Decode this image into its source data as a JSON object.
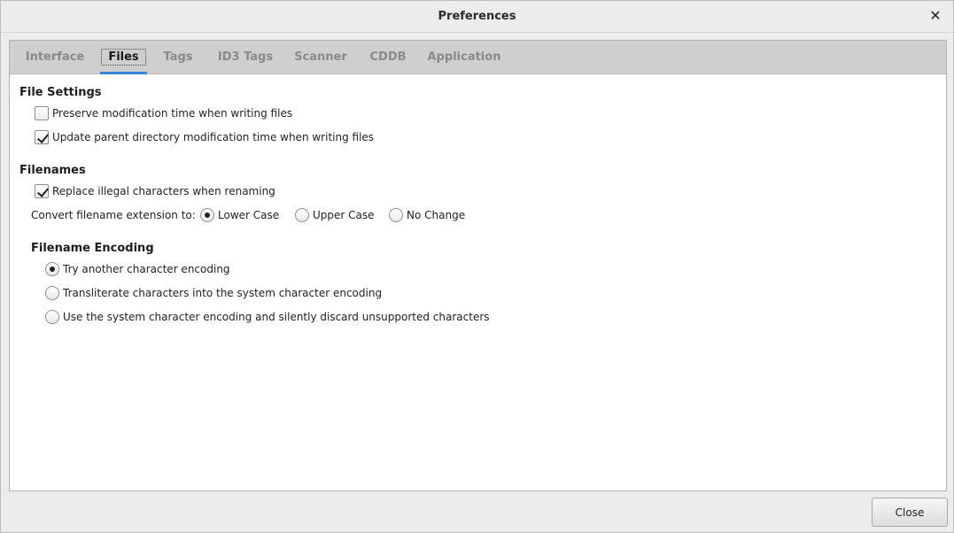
{
  "window": {
    "title": "Preferences",
    "close_icon": "close-icon"
  },
  "tabs": [
    {
      "label": "Interface",
      "active": false
    },
    {
      "label": "Files",
      "active": true
    },
    {
      "label": "Tags",
      "active": false
    },
    {
      "label": "ID3 Tags",
      "active": false
    },
    {
      "label": "Scanner",
      "active": false
    },
    {
      "label": "CDDB",
      "active": false
    },
    {
      "label": "Application",
      "active": false
    }
  ],
  "file_settings": {
    "heading": "File Settings",
    "preserve_mtime": {
      "label": "Preserve modification time when writing files",
      "checked": false
    },
    "update_parent_mtime": {
      "label": "Update parent directory modification time when writing files",
      "checked": true
    }
  },
  "filenames": {
    "heading": "Filenames",
    "replace_illegal": {
      "label": "Replace illegal characters when renaming",
      "checked": true
    },
    "extension_label": "Convert filename extension to:",
    "extension_options": [
      {
        "label": "Lower Case",
        "selected": true
      },
      {
        "label": "Upper Case",
        "selected": false
      },
      {
        "label": "No Change",
        "selected": false
      }
    ]
  },
  "filename_encoding": {
    "heading": "Filename Encoding",
    "options": [
      {
        "label": "Try another character encoding",
        "selected": true
      },
      {
        "label": "Transliterate characters into the system character encoding",
        "selected": false
      },
      {
        "label": "Use the system character encoding and silently discard unsupported characters",
        "selected": false
      }
    ]
  },
  "footer": {
    "close_label": "Close"
  },
  "colors": {
    "accent": "#3b86d3",
    "tabbar": "#cfcfcf"
  }
}
